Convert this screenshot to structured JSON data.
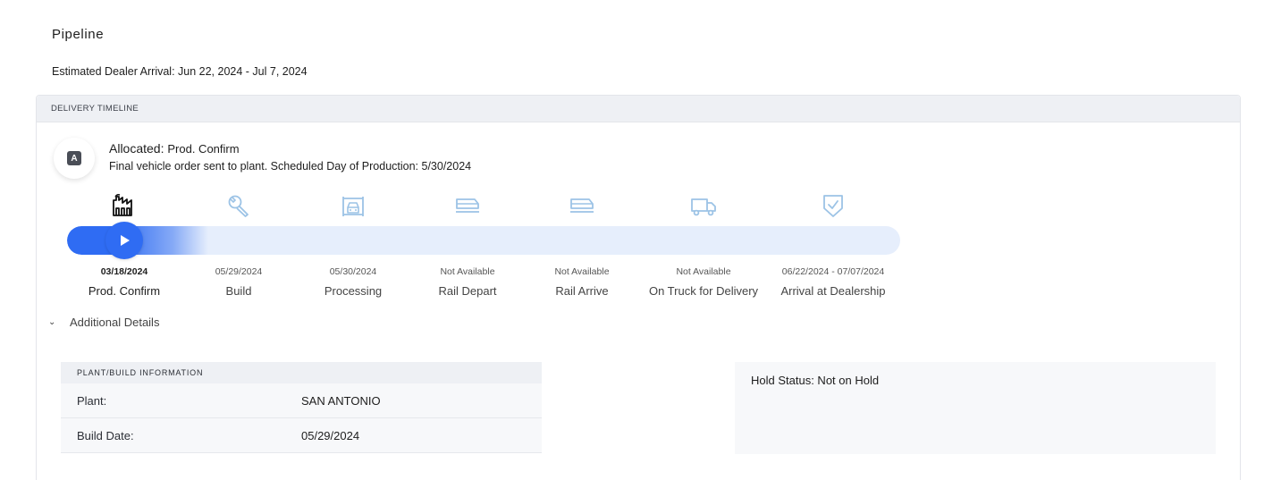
{
  "page": {
    "title": "Pipeline",
    "eta_label": "Estimated Dealer Arrival: Jun 22, 2024 - Jul 7, 2024"
  },
  "timeline": {
    "header": "DELIVERY TIMELINE",
    "status_badge": "A",
    "status_title": "Allocated:",
    "status_stage": "Prod. Confirm",
    "status_description": "Final vehicle order sent to plant. Scheduled Day of Production: 5/30/2024",
    "progress_fraction": 0.13,
    "colors": {
      "accent": "#2f6cf3",
      "inactive_icon": "#9cc3e6",
      "track": "#e6eefc"
    },
    "steps": [
      {
        "icon": "factory-icon",
        "date": "03/18/2024",
        "label": "Prod. Confirm",
        "active": true
      },
      {
        "icon": "wrench-icon",
        "date": "05/29/2024",
        "label": "Build",
        "active": false
      },
      {
        "icon": "processing-icon",
        "date": "05/30/2024",
        "label": "Processing",
        "active": false
      },
      {
        "icon": "rail-icon",
        "date": "Not Available",
        "label": "Rail Depart",
        "active": false
      },
      {
        "icon": "rail-icon",
        "date": "Not Available",
        "label": "Rail Arrive",
        "active": false
      },
      {
        "icon": "truck-icon",
        "date": "Not Available",
        "label": "On Truck for Delivery",
        "active": false
      },
      {
        "icon": "shield-check-icon",
        "date": "06/22/2024 - 07/07/2024",
        "label": "Arrival at Dealership",
        "active": false
      }
    ]
  },
  "details": {
    "toggle_label": "Additional Details",
    "plant_panel": {
      "header": "PLANT/BUILD INFORMATION",
      "rows": [
        {
          "key": "Plant:",
          "value": "SAN ANTONIO"
        },
        {
          "key": "Build Date:",
          "value": "05/29/2024"
        }
      ]
    },
    "hold_status": "Hold Status: Not on Hold"
  }
}
